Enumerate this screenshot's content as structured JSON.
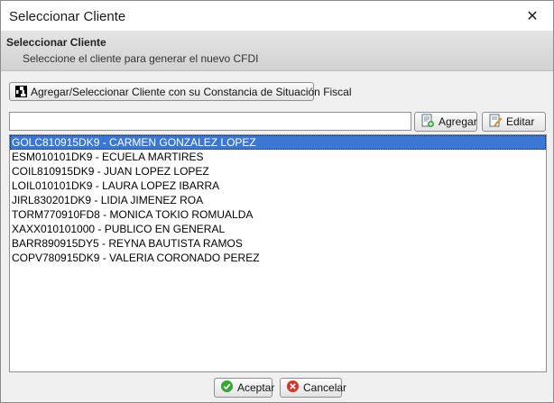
{
  "window": {
    "title": "Seleccionar Cliente",
    "close_glyph": "✕"
  },
  "header": {
    "title": "Seleccionar Cliente",
    "subtitle": "Seleccione el cliente para generar el nuevo CFDI"
  },
  "toolbar": {
    "qr_button_label": "Agregar/Seleccionar Cliente con su Constancia de Situación Fiscal",
    "qr_icon": "qr-code-icon"
  },
  "search": {
    "value": "",
    "placeholder": "",
    "agregar_label": "Agregar",
    "agregar_icon": "add-document-icon",
    "editar_label": "Editar",
    "editar_icon": "edit-document-icon"
  },
  "clients": [
    {
      "label": "GOLC810915DK9 - CARMEN GONZALEZ LOPEZ",
      "selected": true
    },
    {
      "label": "ESM010101DK9 - ECUELA MARTIRES",
      "selected": false
    },
    {
      "label": "COIL810915DK9 - JUAN LOPEZ LOPEZ",
      "selected": false
    },
    {
      "label": "LOIL010101DK9 - LAURA LOPEZ IBARRA",
      "selected": false
    },
    {
      "label": "JIRL830201DK9 - LIDIA JIMENEZ ROA",
      "selected": false
    },
    {
      "label": "TORM770910FD8 - MONICA TOKIO ROMUALDA",
      "selected": false
    },
    {
      "label": "XAXX010101000 - PUBLICO EN GENERAL",
      "selected": false
    },
    {
      "label": "BARR890915DY5 - REYNA BAUTISTA RAMOS",
      "selected": false
    },
    {
      "label": "COPV780915DK9 - VALERIA CORONADO PEREZ",
      "selected": false
    }
  ],
  "footer": {
    "accept_label": "Aceptar",
    "accept_icon": "check-circle-icon",
    "accept_color": "#3aa635",
    "cancel_label": "Cancelar",
    "cancel_icon": "cancel-circle-icon",
    "cancel_color": "#d9342b"
  },
  "colors": {
    "selection": "#3b78d3"
  }
}
